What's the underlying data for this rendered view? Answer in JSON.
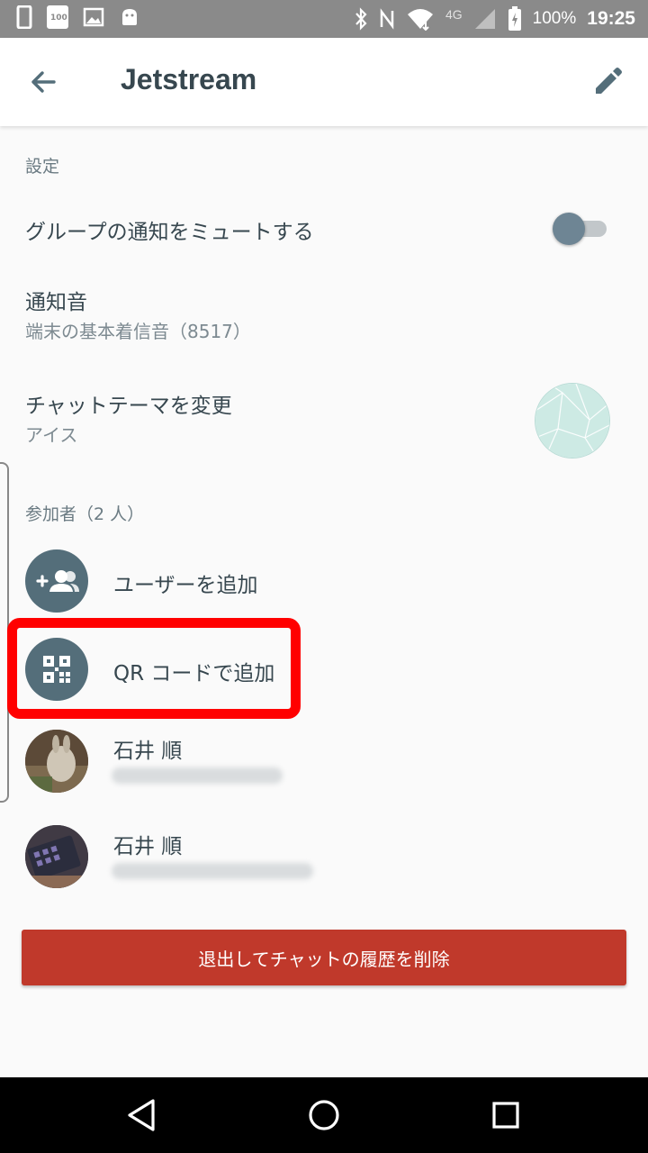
{
  "status_bar": {
    "network": "4G",
    "battery_percent": "100%",
    "time": "19:25",
    "badge": "100",
    "icons": [
      "phone-icon",
      "calendar-icon",
      "image-icon",
      "android-icon",
      "bluetooth-icon",
      "nfc-icon",
      "wifi-icon",
      "signal-icon",
      "battery-icon"
    ]
  },
  "app_bar": {
    "title": "Jetstream",
    "back_icon": "arrow-back-icon",
    "edit_icon": "pencil-icon"
  },
  "settings": {
    "section_label": "設定",
    "mute": {
      "label": "グループの通知をミュートする",
      "enabled": false
    },
    "sound": {
      "label": "通知音",
      "value": "端末の基本着信音（8517）"
    },
    "theme": {
      "label": "チャットテーマを変更",
      "value": "アイス",
      "color": "#cdeae4"
    }
  },
  "participants": {
    "section_label": "参加者（2 人）",
    "add_user": "ユーザーを追加",
    "add_by_qr": "QR コードで追加",
    "members": [
      {
        "name": "石井 順"
      },
      {
        "name": "石井 順"
      }
    ]
  },
  "leave_button": "退出してチャットの履歴を削除",
  "colors": {
    "accent": "#546e7a",
    "danger": "#c0392b",
    "highlight": "#ff0000"
  },
  "nav": [
    "back-triangle-icon",
    "home-circle-icon",
    "recents-square-icon"
  ]
}
